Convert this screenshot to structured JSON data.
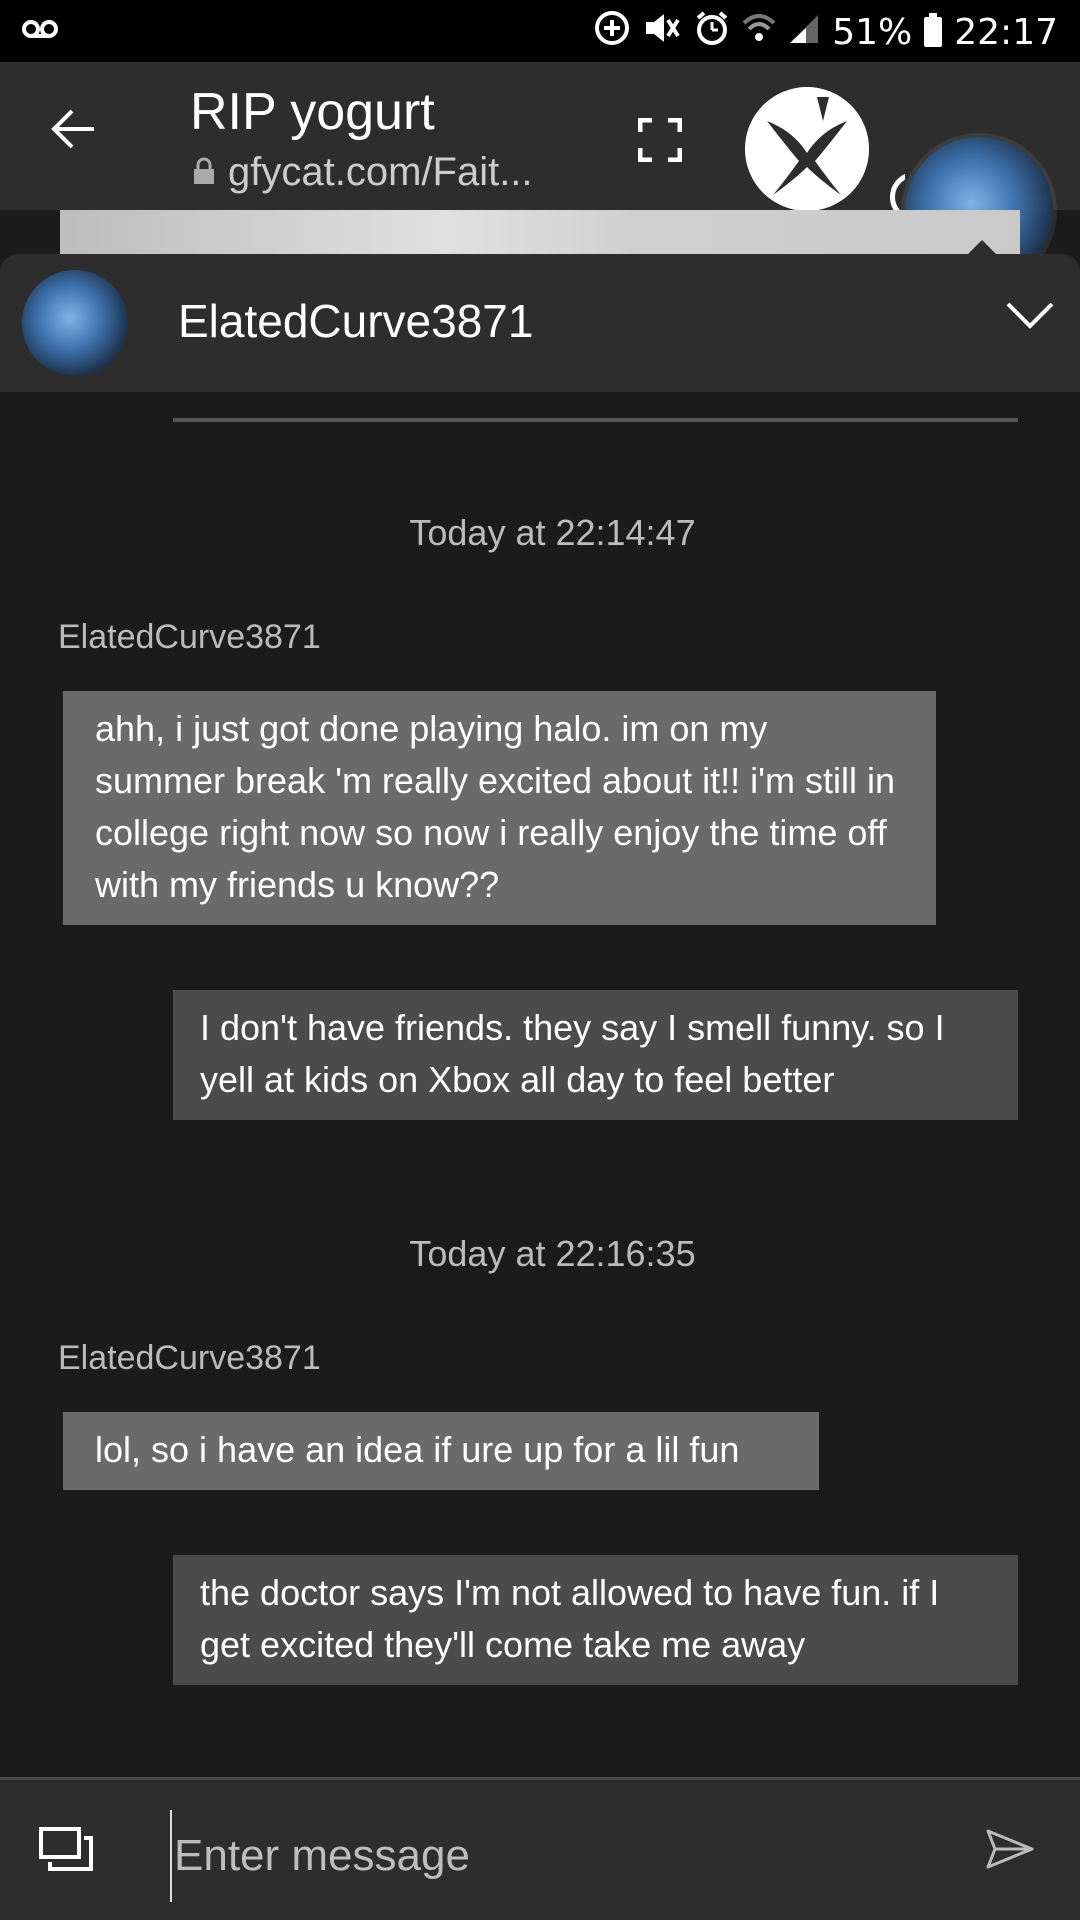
{
  "status_bar": {
    "battery": "51%",
    "time": "22:17",
    "voicemail_icon": "voicemail-icon",
    "icons": [
      "add-circle-icon",
      "mute-vibrate-icon",
      "alarm-icon",
      "wifi-icon",
      "signal-icon",
      "battery-icon"
    ]
  },
  "browser": {
    "title": "RIP yogurt",
    "url": "gfycat.com/Fait..."
  },
  "chat": {
    "contact_name": "ElatedCurve3871",
    "messages": [
      {
        "timestamp": "Today at 22:14:47",
        "sender": "ElatedCurve3871",
        "text": "ahh, i just got done playing halo. im on my summer break 'm really excited about it!! i'm still in college right now so now i really enjoy the time off with my friends u know??",
        "reply": "I don't have friends. they say I smell funny. so I yell at kids on Xbox all day to feel better"
      },
      {
        "timestamp": "Today at 22:16:35",
        "sender": "ElatedCurve3871",
        "text": "lol, so i have an idea if ure up for a lil fun",
        "reply": "the doctor says I'm not allowed to have fun. if I get excited they'll come take me away"
      }
    ]
  },
  "compose": {
    "placeholder": "Enter message"
  },
  "colors": {
    "background": "#1b1b1b",
    "panel": "#2d2d2d",
    "incoming_bubble": "#6a6a6a",
    "outgoing_bubble": "#4b4b4b"
  }
}
